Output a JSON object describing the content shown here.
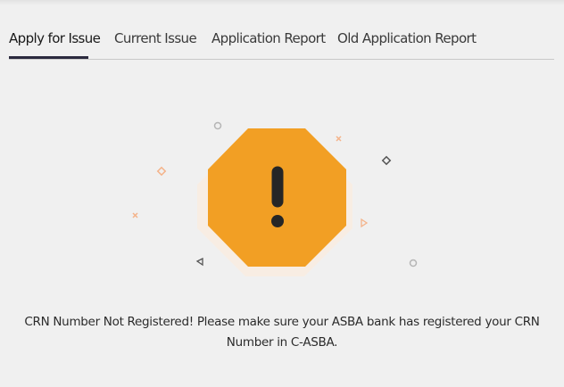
{
  "tabs": [
    {
      "label": "Apply for Issue",
      "active": true
    },
    {
      "label": "Current Issue",
      "active": false
    },
    {
      "label": "Application Report",
      "active": false
    },
    {
      "label": "Old Application Report",
      "active": false
    }
  ],
  "alert": {
    "icon": "warning-octagon-icon",
    "icon_color": "#f29f24",
    "message": "CRN Number Not Registered! Please make sure your ASBA bank has registered your CRN Number in C-ASBA."
  }
}
